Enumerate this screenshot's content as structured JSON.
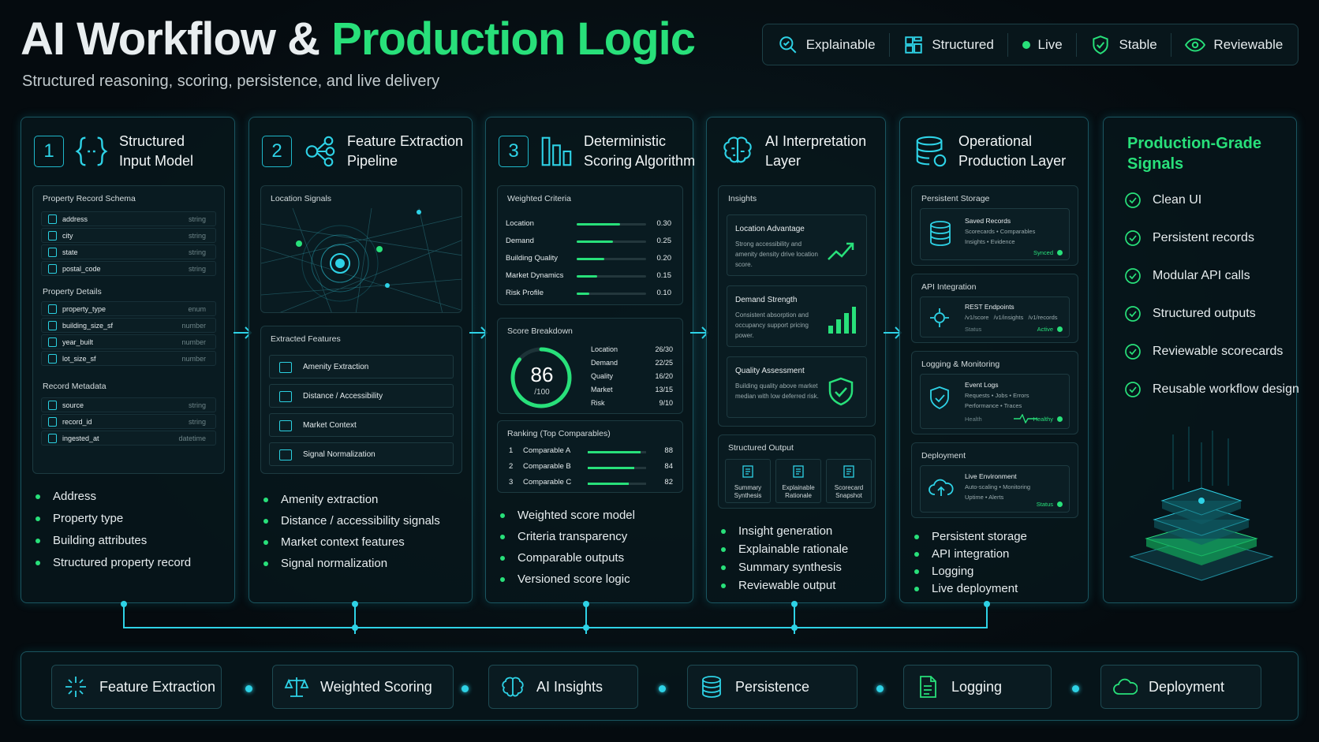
{
  "header": {
    "title_main": "AI Workflow &",
    "title_accent": "Production Logic",
    "subtitle": "Structured reasoning, scoring, persistence, and live delivery"
  },
  "badges": [
    {
      "label": "Explainable",
      "icon": "magnifier-icon"
    },
    {
      "label": "Structured",
      "icon": "layout-icon"
    },
    {
      "label": "Live",
      "icon": "green-dot"
    },
    {
      "label": "Stable",
      "icon": "shield-check-icon"
    },
    {
      "label": "Reviewable",
      "icon": "eye-icon"
    }
  ],
  "col1": {
    "num": "1",
    "title": "Structured Input Model",
    "schema_title": "Property Record Schema",
    "schema": [
      {
        "n": "address",
        "t": "string"
      },
      {
        "n": "city",
        "t": "string"
      },
      {
        "n": "state",
        "t": "string"
      },
      {
        "n": "postal_code",
        "t": "string"
      }
    ],
    "details_title": "Property Details",
    "details": [
      {
        "n": "property_type",
        "t": "enum"
      },
      {
        "n": "building_size_sf",
        "t": "number"
      },
      {
        "n": "year_built",
        "t": "number"
      },
      {
        "n": "lot_size_sf",
        "t": "number"
      }
    ],
    "meta_title": "Record Metadata",
    "meta": [
      {
        "n": "source",
        "t": "string"
      },
      {
        "n": "record_id",
        "t": "string"
      },
      {
        "n": "ingested_at",
        "t": "datetime"
      }
    ],
    "bullets": [
      "Address",
      "Property type",
      "Building attributes",
      "Structured property record"
    ]
  },
  "col2": {
    "num": "2",
    "title": "Feature Extraction Pipeline",
    "signals_title": "Location Signals",
    "features_title": "Extracted Features",
    "features": [
      "Amenity Extraction",
      "Distance / Accessibility",
      "Market Context",
      "Signal Normalization"
    ],
    "bullets": [
      "Amenity extraction",
      "Distance / accessibility signals",
      "Market context features",
      "Signal normalization"
    ]
  },
  "col3": {
    "num": "3",
    "title": "Deterministic Scoring Algorithm",
    "criteria_title": "Weighted Criteria",
    "criteria": [
      {
        "n": "Location",
        "v": "0.30",
        "f": 0.62
      },
      {
        "n": "Demand",
        "v": "0.25",
        "f": 0.52
      },
      {
        "n": "Building Quality",
        "v": "0.20",
        "f": 0.4
      },
      {
        "n": "Market Dynamics",
        "v": "0.15",
        "f": 0.3
      },
      {
        "n": "Risk Profile",
        "v": "0.10",
        "f": 0.18
      }
    ],
    "breakdown_title": "Score Breakdown",
    "score": "86",
    "score_max": "/100",
    "score_value": 86,
    "breakdown": [
      {
        "n": "Location",
        "v": "26/30"
      },
      {
        "n": "Demand",
        "v": "22/25"
      },
      {
        "n": "Quality",
        "v": "16/20"
      },
      {
        "n": "Market",
        "v": "13/15"
      },
      {
        "n": "Risk",
        "v": "9/10"
      }
    ],
    "ranking_title": "Ranking (Top Comparables)",
    "ranking": [
      {
        "r": "1",
        "n": "Comparable A",
        "v": "88",
        "f": 0.9
      },
      {
        "r": "2",
        "n": "Comparable B",
        "v": "84",
        "f": 0.8
      },
      {
        "r": "3",
        "n": "Comparable C",
        "v": "82",
        "f": 0.7
      }
    ],
    "bullets": [
      "Weighted score model",
      "Criteria transparency",
      "Comparable outputs",
      "Versioned score logic"
    ]
  },
  "col4": {
    "title": "AI Interpretation Layer",
    "insights_title": "Insights",
    "insights": [
      {
        "n": "Location Advantage",
        "d": "Strong accessibility and amenity density drive location score."
      },
      {
        "n": "Demand Strength",
        "d": "Consistent absorption and occupancy support pricing power."
      },
      {
        "n": "Quality Assessment",
        "d": "Building quality above market median with low deferred risk."
      }
    ],
    "output_title": "Structured Output",
    "outputs": [
      "Summary Synthesis",
      "Explainable Rationale",
      "Scorecard Snapshot"
    ],
    "bullets": [
      "Insight generation",
      "Explainable rationale",
      "Summary synthesis",
      "Reviewable output"
    ]
  },
  "col5": {
    "title": "Operational Production Layer",
    "storage_title": "Persistent Storage",
    "storage_name": "Saved Records",
    "storage_desc1": "Scorecards • Comparables",
    "storage_desc2": "Insights • Evidence",
    "storage_status": "Synced",
    "api_title": "API Integration",
    "api_name": "REST Endpoints",
    "api_eps": "/v1/score   /v1/insights   /v1/records",
    "api_status_label": "Status",
    "api_status": "Active",
    "log_title": "Logging & Monitoring",
    "log_name": "Event Logs",
    "log_desc1": "Requests • Jobs • Errors",
    "log_desc2": "Performance • Traces",
    "log_health_label": "Health",
    "log_health": "Healthy",
    "deploy_title": "Deployment",
    "deploy_name": "Live Environment",
    "deploy_desc1": "Auto-scaling • Monitoring",
    "deploy_desc2": "Uptime • Alerts",
    "deploy_status": "Status",
    "bullets": [
      "Persistent storage",
      "API integration",
      "Logging",
      "Live deployment"
    ]
  },
  "col6": {
    "title": "Production-Grade Signals",
    "signals": [
      "Clean UI",
      "Persistent records",
      "Modular API calls",
      "Structured outputs",
      "Reviewable scorecards",
      "Reusable workflow design"
    ]
  },
  "bottom": [
    "Feature Extraction",
    "Weighted Scoring",
    "AI Insights",
    "Persistence",
    "Logging",
    "Deployment"
  ],
  "colors": {
    "accent": "#28e07a",
    "cyan": "#2ed2e6"
  }
}
